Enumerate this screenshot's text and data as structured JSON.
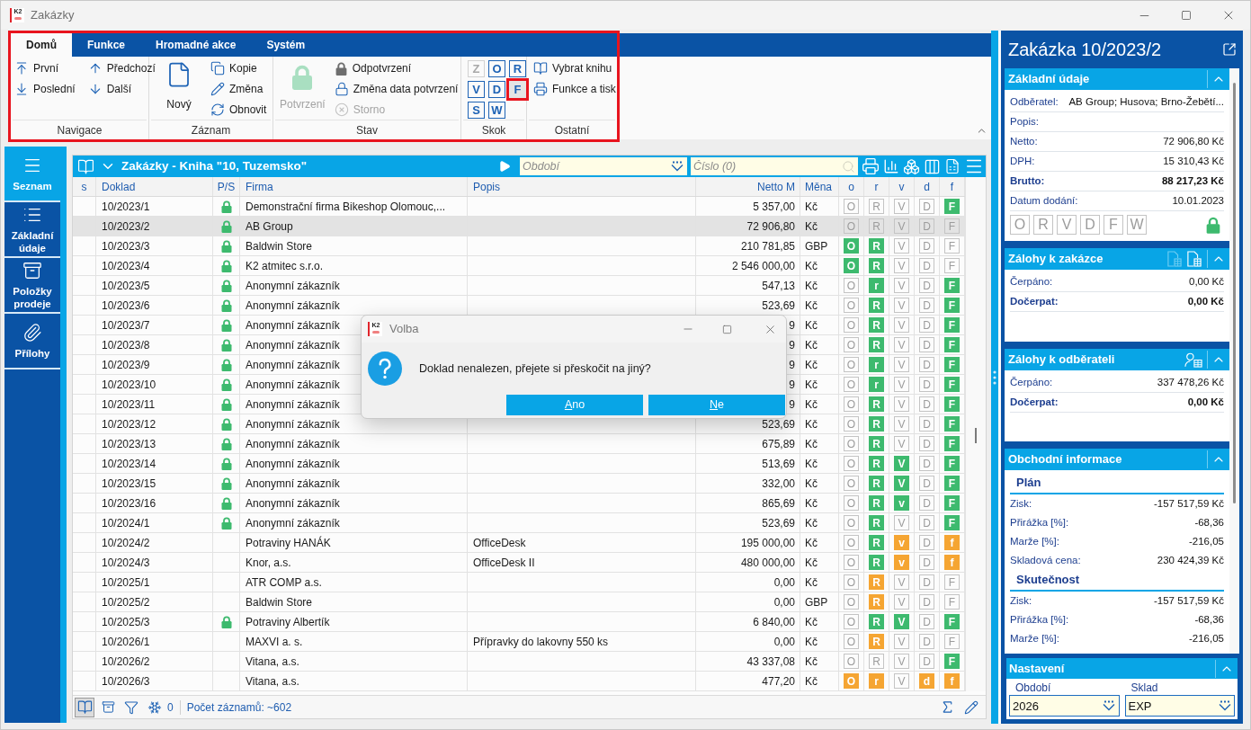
{
  "window": {
    "logo": "K2",
    "title": "Zakázky"
  },
  "ribbon": {
    "highlighted": true,
    "tabs": [
      {
        "label": "Domů",
        "selected": true
      },
      {
        "label": "Funkce",
        "selected": false
      },
      {
        "label": "Hromadné akce",
        "selected": false
      },
      {
        "label": "Systém",
        "selected": false
      }
    ],
    "groups": [
      {
        "kind": "grid",
        "label": "Navigace",
        "items": [
          {
            "label": "První"
          },
          {
            "label": "Poslední"
          },
          {
            "label": "Předchozí"
          },
          {
            "label": "Další"
          }
        ]
      },
      {
        "kind": "mixed",
        "label": "Záznam",
        "big": {
          "label": "Nový"
        },
        "items": [
          {
            "label": "Kopie"
          },
          {
            "label": "Změna"
          },
          {
            "label": "Obnovit"
          }
        ]
      },
      {
        "kind": "mixed",
        "label": "Stav",
        "big": {
          "label": "Potvrzení",
          "disabled": true
        },
        "items": [
          {
            "label": "Odpotvrzení",
            "disabled": false
          },
          {
            "label": "Změna data potvrzení",
            "disabled": false
          },
          {
            "label": "Storno",
            "disabled": true
          }
        ]
      },
      {
        "kind": "letters",
        "label": "Skok",
        "items": [
          {
            "letter": "Z",
            "disabled": true,
            "highlighted": false
          },
          {
            "letter": "O",
            "disabled": false,
            "highlighted": false
          },
          {
            "letter": "R",
            "disabled": false,
            "highlighted": false
          },
          {
            "letter": "V",
            "disabled": false,
            "highlighted": false
          },
          {
            "letter": "D",
            "disabled": false,
            "highlighted": false
          },
          {
            "letter": "F",
            "disabled": false,
            "highlighted": true
          },
          {
            "letter": "S",
            "disabled": false,
            "highlighted": false
          },
          {
            "letter": "W",
            "disabled": false,
            "highlighted": false
          }
        ]
      },
      {
        "kind": "list",
        "label": "Ostatní",
        "items": [
          {
            "label": "Vybrat knihu"
          },
          {
            "label": "Funkce a tisk"
          }
        ]
      }
    ]
  },
  "nav": [
    {
      "label": "Seznam",
      "selected": true
    },
    {
      "label": "Základní údaje",
      "selected": false
    },
    {
      "label": "Položky prodeje",
      "selected": false
    },
    {
      "label": "Přílohy",
      "selected": false
    }
  ],
  "list": {
    "title": "Zakázky - Kniha \"10, Tuzemsko\"",
    "period_field": {
      "placeholder": "Období"
    },
    "number_field": {
      "placeholder": "Číslo (0)"
    },
    "columns": [
      "s",
      "Doklad",
      "P/S",
      "Firma",
      "Popis",
      "Netto M",
      "Měna",
      "o",
      "r",
      "v",
      "d",
      "f"
    ],
    "rows": [
      {
        "doklad": "10/2023/1",
        "locked": true,
        "firma": "Demonstrační firma Bikeshop Olomouc,...",
        "netto": "5 357,00",
        "currency": "Kč",
        "selected": false,
        "flags": [
          {
            "letter": "O",
            "active": false
          },
          {
            "letter": "R",
            "active": false
          },
          {
            "letter": "V",
            "active": false
          },
          {
            "letter": "D",
            "active": false
          },
          {
            "letter": "F",
            "active": true,
            "color": "#3dba6e"
          }
        ]
      },
      {
        "doklad": "10/2023/2",
        "locked": true,
        "firma": "AB Group",
        "netto": "72 906,80",
        "currency": "Kč",
        "selected": true,
        "flags": [
          {
            "letter": "O",
            "active": false
          },
          {
            "letter": "R",
            "active": false
          },
          {
            "letter": "V",
            "active": false
          },
          {
            "letter": "D",
            "active": false
          },
          {
            "letter": "F",
            "active": false
          }
        ]
      },
      {
        "doklad": "10/2023/3",
        "locked": true,
        "firma": "Baldwin Store",
        "netto": "210 781,85",
        "currency": "GBP",
        "selected": false,
        "flags": [
          {
            "letter": "O",
            "active": true,
            "color": "#3dba6e"
          },
          {
            "letter": "R",
            "active": true,
            "color": "#3dba6e"
          },
          {
            "letter": "V",
            "active": false
          },
          {
            "letter": "D",
            "active": false
          },
          {
            "letter": "F",
            "active": false
          }
        ]
      },
      {
        "doklad": "10/2023/4",
        "locked": true,
        "firma": "K2 atmitec s.r.o.",
        "netto": "2 546 000,00",
        "currency": "Kč",
        "selected": false,
        "flags": [
          {
            "letter": "O",
            "active": true,
            "color": "#3dba6e"
          },
          {
            "letter": "R",
            "active": true,
            "color": "#3dba6e"
          },
          {
            "letter": "V",
            "active": false
          },
          {
            "letter": "D",
            "active": false
          },
          {
            "letter": "F",
            "active": false
          }
        ]
      },
      {
        "doklad": "10/2023/5",
        "locked": true,
        "firma": "Anonymní zákazník",
        "netto": "547,13",
        "currency": "Kč",
        "selected": false,
        "flags": [
          {
            "letter": "O",
            "active": false
          },
          {
            "letter": "r",
            "active": true,
            "color": "#3dba6e"
          },
          {
            "letter": "V",
            "active": false
          },
          {
            "letter": "D",
            "active": false
          },
          {
            "letter": "F",
            "active": true,
            "color": "#3dba6e"
          }
        ]
      },
      {
        "doklad": "10/2023/6",
        "locked": true,
        "firma": "Anonymní zákazník",
        "netto": "523,69",
        "currency": "Kč",
        "selected": false,
        "flags": [
          {
            "letter": "O",
            "active": false
          },
          {
            "letter": "R",
            "active": true,
            "color": "#3dba6e"
          },
          {
            "letter": "V",
            "active": false
          },
          {
            "letter": "D",
            "active": false
          },
          {
            "letter": "F",
            "active": true,
            "color": "#3dba6e"
          }
        ]
      },
      {
        "doklad": "10/2023/7",
        "locked": true,
        "firma": "Anonymní zákazník",
        "netto": "9",
        "currency": "Kč",
        "selected": false,
        "flags": [
          {
            "letter": "O",
            "active": false
          },
          {
            "letter": "R",
            "active": true,
            "color": "#3dba6e"
          },
          {
            "letter": "V",
            "active": false
          },
          {
            "letter": "D",
            "active": false
          },
          {
            "letter": "F",
            "active": true,
            "color": "#3dba6e"
          }
        ]
      },
      {
        "doklad": "10/2023/8",
        "locked": true,
        "firma": "Anonymní zákazník",
        "netto": "9",
        "currency": "Kč",
        "selected": false,
        "flags": [
          {
            "letter": "O",
            "active": false
          },
          {
            "letter": "R",
            "active": true,
            "color": "#3dba6e"
          },
          {
            "letter": "V",
            "active": false
          },
          {
            "letter": "D",
            "active": false
          },
          {
            "letter": "F",
            "active": true,
            "color": "#3dba6e"
          }
        ]
      },
      {
        "doklad": "10/2023/9",
        "locked": true,
        "firma": "Anonymní zákazník",
        "netto": "9",
        "currency": "Kč",
        "selected": false,
        "flags": [
          {
            "letter": "O",
            "active": false
          },
          {
            "letter": "r",
            "active": true,
            "color": "#3dba6e"
          },
          {
            "letter": "V",
            "active": false
          },
          {
            "letter": "D",
            "active": false
          },
          {
            "letter": "F",
            "active": true,
            "color": "#3dba6e"
          }
        ]
      },
      {
        "doklad": "10/2023/10",
        "locked": true,
        "firma": "Anonymní zákazník",
        "netto": "9",
        "currency": "Kč",
        "selected": false,
        "flags": [
          {
            "letter": "O",
            "active": false
          },
          {
            "letter": "r",
            "active": true,
            "color": "#3dba6e"
          },
          {
            "letter": "V",
            "active": false
          },
          {
            "letter": "D",
            "active": false
          },
          {
            "letter": "F",
            "active": true,
            "color": "#3dba6e"
          }
        ]
      },
      {
        "doklad": "10/2023/11",
        "locked": true,
        "firma": "Anonymní zákazník",
        "netto": "9",
        "currency": "Kč",
        "selected": false,
        "flags": [
          {
            "letter": "O",
            "active": false
          },
          {
            "letter": "R",
            "active": true,
            "color": "#3dba6e"
          },
          {
            "letter": "V",
            "active": false
          },
          {
            "letter": "D",
            "active": false
          },
          {
            "letter": "F",
            "active": true,
            "color": "#3dba6e"
          }
        ]
      },
      {
        "doklad": "10/2023/12",
        "locked": true,
        "firma": "Anonymní zákazník",
        "netto": "523,69",
        "currency": "Kč",
        "selected": false,
        "flags": [
          {
            "letter": "O",
            "active": false
          },
          {
            "letter": "R",
            "active": true,
            "color": "#3dba6e"
          },
          {
            "letter": "V",
            "active": false
          },
          {
            "letter": "D",
            "active": false
          },
          {
            "letter": "F",
            "active": true,
            "color": "#3dba6e"
          }
        ]
      },
      {
        "doklad": "10/2023/13",
        "locked": true,
        "firma": "Anonymní zákazník",
        "netto": "675,89",
        "currency": "Kč",
        "selected": false,
        "flags": [
          {
            "letter": "O",
            "active": false
          },
          {
            "letter": "R",
            "active": true,
            "color": "#3dba6e"
          },
          {
            "letter": "V",
            "active": false
          },
          {
            "letter": "D",
            "active": false
          },
          {
            "letter": "F",
            "active": true,
            "color": "#3dba6e"
          }
        ]
      },
      {
        "doklad": "10/2023/14",
        "locked": true,
        "firma": "Anonymní zákazník",
        "netto": "513,69",
        "currency": "Kč",
        "selected": false,
        "flags": [
          {
            "letter": "O",
            "active": false
          },
          {
            "letter": "R",
            "active": true,
            "color": "#3dba6e"
          },
          {
            "letter": "V",
            "active": true,
            "color": "#3dba6e"
          },
          {
            "letter": "D",
            "active": false
          },
          {
            "letter": "F",
            "active": true,
            "color": "#3dba6e"
          }
        ]
      },
      {
        "doklad": "10/2023/15",
        "locked": true,
        "firma": "Anonymní zákazník",
        "netto": "332,00",
        "currency": "Kč",
        "selected": false,
        "flags": [
          {
            "letter": "O",
            "active": false
          },
          {
            "letter": "R",
            "active": true,
            "color": "#3dba6e"
          },
          {
            "letter": "V",
            "active": true,
            "color": "#3dba6e"
          },
          {
            "letter": "D",
            "active": false
          },
          {
            "letter": "F",
            "active": true,
            "color": "#3dba6e"
          }
        ]
      },
      {
        "doklad": "10/2023/16",
        "locked": true,
        "firma": "Anonymní zákazník",
        "netto": "865,69",
        "currency": "Kč",
        "selected": false,
        "flags": [
          {
            "letter": "O",
            "active": false
          },
          {
            "letter": "R",
            "active": true,
            "color": "#3dba6e"
          },
          {
            "letter": "v",
            "active": true,
            "color": "#3dba6e"
          },
          {
            "letter": "D",
            "active": false
          },
          {
            "letter": "F",
            "active": true,
            "color": "#3dba6e"
          }
        ]
      },
      {
        "doklad": "10/2024/1",
        "locked": true,
        "firma": "Anonymní zákazník",
        "netto": "523,69",
        "currency": "Kč",
        "selected": false,
        "flags": [
          {
            "letter": "O",
            "active": false
          },
          {
            "letter": "R",
            "active": true,
            "color": "#3dba6e"
          },
          {
            "letter": "V",
            "active": false
          },
          {
            "letter": "D",
            "active": false
          },
          {
            "letter": "F",
            "active": true,
            "color": "#3dba6e"
          }
        ]
      },
      {
        "doklad": "10/2024/2",
        "locked": false,
        "firma": "Potraviny HANÁK",
        "popis": "OfficeDesk",
        "netto": "195 000,00",
        "currency": "Kč",
        "selected": false,
        "flags": [
          {
            "letter": "O",
            "active": false
          },
          {
            "letter": "R",
            "active": true,
            "color": "#3dba6e"
          },
          {
            "letter": "v",
            "active": true,
            "color": "#f5a532"
          },
          {
            "letter": "D",
            "active": false
          },
          {
            "letter": "f",
            "active": true,
            "color": "#f5a532"
          }
        ]
      },
      {
        "doklad": "10/2024/3",
        "locked": false,
        "firma": "Knor, a.s.",
        "popis": "OfficeDesk II",
        "netto": "480 000,00",
        "currency": "Kč",
        "selected": false,
        "flags": [
          {
            "letter": "O",
            "active": false
          },
          {
            "letter": "R",
            "active": true,
            "color": "#3dba6e"
          },
          {
            "letter": "v",
            "active": true,
            "color": "#f5a532"
          },
          {
            "letter": "D",
            "active": false
          },
          {
            "letter": "f",
            "active": true,
            "color": "#f5a532"
          }
        ]
      },
      {
        "doklad": "10/2025/1",
        "locked": false,
        "firma": "ATR COMP a.s.",
        "netto": "0,00",
        "currency": "Kč",
        "selected": false,
        "flags": [
          {
            "letter": "O",
            "active": false
          },
          {
            "letter": "R",
            "active": true,
            "color": "#f5a532"
          },
          {
            "letter": "V",
            "active": false
          },
          {
            "letter": "D",
            "active": false
          },
          {
            "letter": "F",
            "active": false
          }
        ]
      },
      {
        "doklad": "10/2025/2",
        "locked": false,
        "firma": "Baldwin Store",
        "netto": "0,00",
        "currency": "GBP",
        "selected": false,
        "flags": [
          {
            "letter": "O",
            "active": false
          },
          {
            "letter": "R",
            "active": true,
            "color": "#f5a532"
          },
          {
            "letter": "V",
            "active": false
          },
          {
            "letter": "D",
            "active": false
          },
          {
            "letter": "F",
            "active": false
          }
        ]
      },
      {
        "doklad": "10/2025/3",
        "locked": true,
        "firma": "Potraviny Albertík",
        "netto": "6 840,00",
        "currency": "Kč",
        "selected": false,
        "flags": [
          {
            "letter": "O",
            "active": false
          },
          {
            "letter": "R",
            "active": true,
            "color": "#3dba6e"
          },
          {
            "letter": "V",
            "active": true,
            "color": "#3dba6e"
          },
          {
            "letter": "D",
            "active": false
          },
          {
            "letter": "F",
            "active": true,
            "color": "#3dba6e"
          }
        ]
      },
      {
        "doklad": "10/2026/1",
        "locked": false,
        "firma": "MAXVI a. s.",
        "popis": "Přípravky do lakovny 550 ks",
        "netto": "0,00",
        "currency": "Kč",
        "selected": false,
        "flags": [
          {
            "letter": "O",
            "active": false
          },
          {
            "letter": "R",
            "active": true,
            "color": "#f5a532"
          },
          {
            "letter": "V",
            "active": false
          },
          {
            "letter": "D",
            "active": false
          },
          {
            "letter": "F",
            "active": false
          }
        ]
      },
      {
        "doklad": "10/2026/2",
        "locked": false,
        "firma": "Vitana, a.s.",
        "netto": "43 337,08",
        "currency": "Kč",
        "selected": false,
        "flags": [
          {
            "letter": "O",
            "active": false
          },
          {
            "letter": "R",
            "active": false
          },
          {
            "letter": "V",
            "active": false
          },
          {
            "letter": "D",
            "active": false
          },
          {
            "letter": "F",
            "active": true,
            "color": "#3dba6e"
          }
        ]
      },
      {
        "doklad": "10/2026/3",
        "locked": false,
        "firma": "Vitana, a.s.",
        "netto": "477,20",
        "currency": "Kč",
        "selected": false,
        "flags": [
          {
            "letter": "O",
            "active": true,
            "color": "#f5a532"
          },
          {
            "letter": "r",
            "active": true,
            "color": "#f5a532"
          },
          {
            "letter": "V",
            "active": false
          },
          {
            "letter": "d",
            "active": true,
            "color": "#f5a532"
          },
          {
            "letter": "f",
            "active": true,
            "color": "#f5a532"
          }
        ]
      }
    ],
    "footer": {
      "view_toggle": {
        "selected": true
      },
      "filter_count": "0",
      "record_count": "Počet záznamů: ~602"
    }
  },
  "dialog": {
    "logo": "K2",
    "title": "Volba",
    "message": "Doklad nenalezen, přejete si přeskočit na jiný?",
    "buttons": [
      "Ano",
      "Ne"
    ]
  },
  "detail": {
    "title": "Zakázka 10/2023/2",
    "sections": [
      {
        "kind": "fields",
        "title": "Základní údaje",
        "expanded": true,
        "rows": [
          {
            "label": "Odběratel:",
            "value": "AB Group; Husova; Brno-Žebětí...",
            "bold": false
          },
          {
            "label": "Popis:",
            "bold": false
          },
          {
            "label": "Netto:",
            "value": "72 906,80 Kč",
            "bold": false
          },
          {
            "label": "DPH:",
            "value": "15 310,43 Kč",
            "bold": false
          },
          {
            "label": "Brutto:",
            "value": "88 217,23 Kč",
            "bold": true
          },
          {
            "label": "Datum dodání:",
            "value": "10.01.2023",
            "bold": false
          }
        ],
        "flags": [
          {
            "letter": "O",
            "active": false
          },
          {
            "letter": "R",
            "active": false
          },
          {
            "letter": "V",
            "active": false
          },
          {
            "letter": "D",
            "active": false
          },
          {
            "letter": "F",
            "active": false
          },
          {
            "letter": "W",
            "active": false
          }
        ],
        "locked": true
      },
      {
        "kind": "fields",
        "title": "Zálohy k zakázce",
        "expanded": true,
        "header_buttons": [
          {
            "disabled": true
          },
          {
            "disabled": false
          }
        ],
        "rows": [
          {
            "label": "Čerpáno:",
            "value": "0,00 Kč",
            "bold": false
          },
          {
            "label": "Dočerpat:",
            "value": "0,00 Kč",
            "bold": true
          }
        ]
      },
      {
        "kind": "fields",
        "title": "Zálohy k odběrateli",
        "expanded": true,
        "header_buttons": [
          {
            "disabled": false
          }
        ],
        "rows": [
          {
            "label": "Čerpáno:",
            "value": "337 478,26 Kč",
            "bold": false
          },
          {
            "label": "Dočerpat:",
            "value": "0,00 Kč",
            "bold": true
          }
        ]
      },
      {
        "kind": "groups",
        "title": "Obchodní informace",
        "expanded": true,
        "groups": [
          {
            "title": "Plán",
            "rows": [
              {
                "label": "Zisk:",
                "value": "-157 517,59 Kč"
              },
              {
                "label": "Přirážka [%]:",
                "value": "-68,36"
              },
              {
                "label": "Marže [%]:",
                "value": "-216,05"
              },
              {
                "label": "Skladová cena:",
                "value": "230 424,39 Kč"
              }
            ]
          },
          {
            "title": "Skutečnost",
            "rows": [
              {
                "label": "Zisk:",
                "value": "-157 517,59 Kč"
              },
              {
                "label": "Přirážka [%]:",
                "value": "-68,36"
              },
              {
                "label": "Marže [%]:",
                "value": "-216,05"
              }
            ]
          }
        ]
      }
    ],
    "settings": {
      "title": "Nastavení",
      "expanded": true,
      "fields": [
        {
          "label": "Období",
          "value": "2026"
        },
        {
          "label": "Sklad",
          "value": "EXP"
        }
      ]
    }
  }
}
